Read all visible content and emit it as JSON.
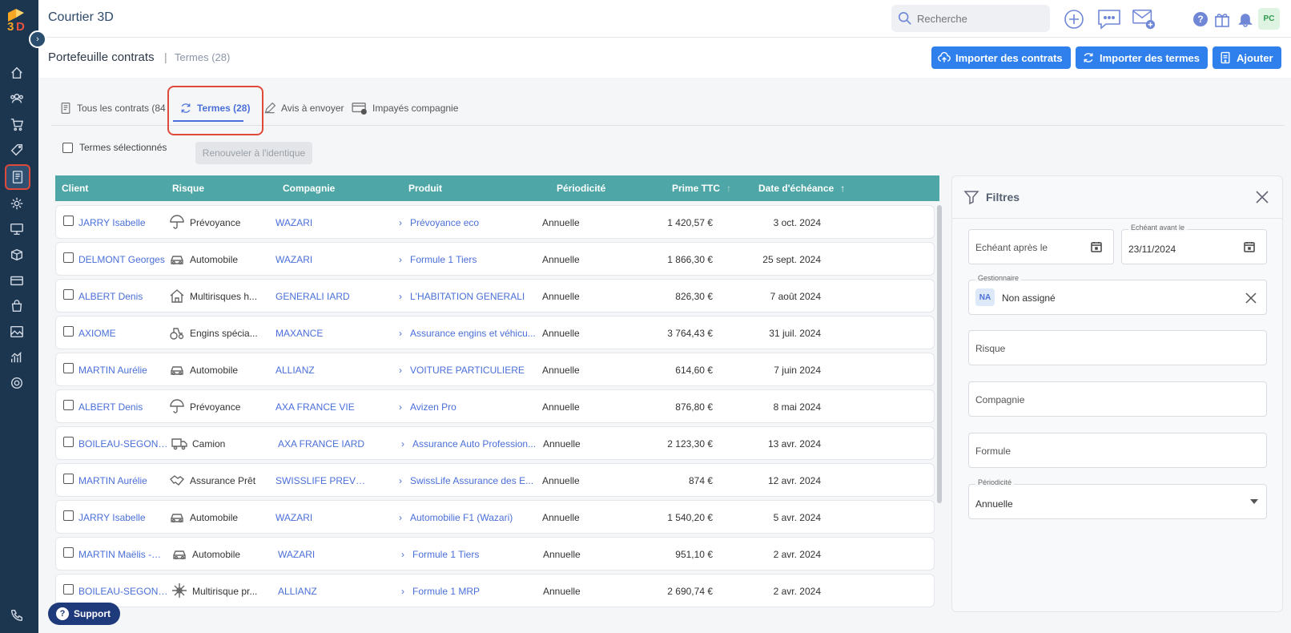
{
  "app": {
    "title": "Courtier 3D"
  },
  "search": {
    "placeholder": "Recherche"
  },
  "user": {
    "initials": "PC"
  },
  "header": {
    "title": "Portefeuille contrats",
    "separator": "|",
    "subtitle": "Termes (28)",
    "buttons": {
      "import_contracts": "Importer des contrats",
      "import_terms": "Importer des termes",
      "add": "Ajouter"
    }
  },
  "tabs": [
    {
      "label": "Tous les contrats (84"
    },
    {
      "label": "Termes (28)"
    },
    {
      "label": "Avis à envoyer"
    },
    {
      "label": "Impayés compagnie"
    }
  ],
  "selection": {
    "checkbox_label": "Termes sélectionnés",
    "renew_button": "Renouveler à l'identique"
  },
  "table": {
    "headers": {
      "client": "Client",
      "risk": "Risque",
      "company": "Compagnie",
      "product": "Produit",
      "period": "Périodicité",
      "premium": "Prime TTC",
      "due": "Date d'échéance"
    },
    "sort_arrow": "↑",
    "rows": [
      {
        "client": "JARRY Isabelle",
        "risk_icon": "umbrella-icon",
        "risk": "Prévoyance",
        "company": "WAZARI",
        "product": "Prévoyance eco",
        "period": "Annuelle",
        "premium": "1 420,57 €",
        "due": "3 oct. 2024"
      },
      {
        "client": "DELMONT Georges",
        "risk_icon": "car-icon",
        "risk": "Automobile",
        "company": "WAZARI",
        "product": "Formule 1 Tiers",
        "period": "Annuelle",
        "premium": "1 866,30 €",
        "due": "25 sept. 2024"
      },
      {
        "client": "ALBERT Denis",
        "risk_icon": "house-icon",
        "risk": "Multirisques h...",
        "company": "GENERALI IARD",
        "product": "L'HABITATION GENERALI",
        "period": "Annuelle",
        "premium": "826,30 €",
        "due": "7 août 2024"
      },
      {
        "client": "AXIOME",
        "risk_icon": "tractor-icon",
        "risk": "Engins spécia...",
        "company": "MAXANCE",
        "product": "Assurance engins et véhicu...",
        "period": "Annuelle",
        "premium": "3 764,43 €",
        "due": "31 juil. 2024"
      },
      {
        "client": "MARTIN Aurélie",
        "risk_icon": "car-icon",
        "risk": "Automobile",
        "company": "ALLIANZ",
        "product": "VOITURE PARTICULIERE",
        "period": "Annuelle",
        "premium": "614,60 €",
        "due": "7 juin 2024"
      },
      {
        "client": "ALBERT Denis",
        "risk_icon": "umbrella-icon",
        "risk": "Prévoyance",
        "company": "AXA FRANCE VIE",
        "product": "Avizen Pro",
        "period": "Annuelle",
        "premium": "876,80 €",
        "due": "8 mai 2024"
      },
      {
        "client": "BOILEAU-SEGONZA...",
        "risk_icon": "truck-icon",
        "risk": "Camion",
        "company": "AXA FRANCE IARD",
        "product": "Assurance Auto Profession...",
        "period": "Annuelle",
        "premium": "2 123,30 €",
        "due": "13 avr. 2024"
      },
      {
        "client": "MARTIN Aurélie",
        "risk_icon": "handshake-icon",
        "risk": "Assurance Prêt",
        "company": "SWISSLIFE PREVOY...",
        "product": "SwissLife Assurance des E...",
        "period": "Annuelle",
        "premium": "874 €",
        "due": "12 avr. 2024"
      },
      {
        "client": "JARRY Isabelle",
        "risk_icon": "car-icon",
        "risk": "Automobile",
        "company": "WAZARI",
        "product": "Automobilie F1 (Wazari)",
        "period": "Annuelle",
        "premium": "1 540,20 €",
        "due": "5 avr. 2024"
      },
      {
        "client": "MARTIN Maëlis -Gaë...",
        "risk_icon": "car-icon",
        "risk": "Automobile",
        "company": "WAZARI",
        "product": "Formule 1 Tiers",
        "period": "Annuelle",
        "premium": "951,10 €",
        "due": "2 avr. 2024"
      },
      {
        "client": "BOILEAU-SEGONZA...",
        "risk_icon": "sparkle-icon",
        "risk": "Multirisque pr...",
        "company": "ALLIANZ",
        "product": "Formule 1 MRP",
        "period": "Annuelle",
        "premium": "2 690,74 €",
        "due": "2 avr. 2024"
      }
    ]
  },
  "filters": {
    "title": "Filtres",
    "due_after_placeholder": "Echéant après le",
    "due_before_label": "Echéant avant le",
    "due_before_value": "23/11/2024",
    "manager_label": "Gestionnaire",
    "manager_badge": "NA",
    "manager_value": "Non assigné",
    "risk_placeholder": "Risque",
    "company_placeholder": "Compagnie",
    "formula_placeholder": "Formule",
    "period_label": "Périodicité",
    "period_value": "Annuelle"
  },
  "support": {
    "label": "Support"
  },
  "colors": {
    "sidebar": "#1d3650",
    "primary": "#2f80ed",
    "table_header": "#4fa6a6",
    "link": "#4a6fd8",
    "highlight": "#e04a3b"
  }
}
